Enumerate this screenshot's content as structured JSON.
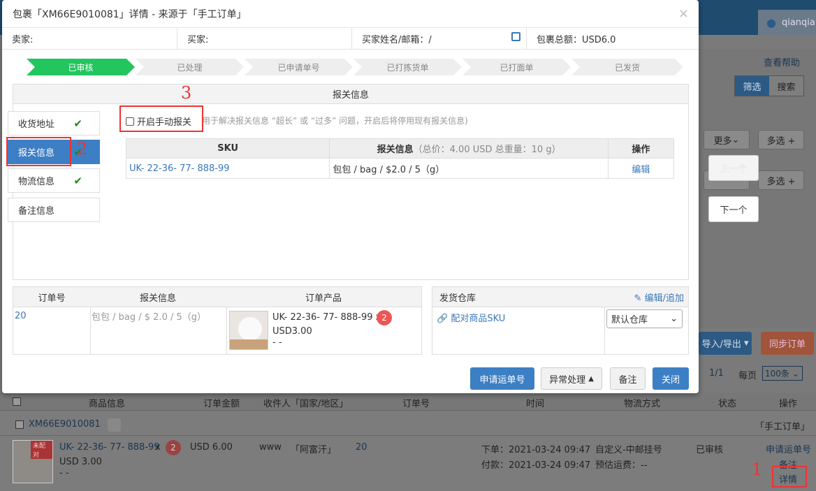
{
  "background": {
    "user_name": "qianqia",
    "help_link": "查看帮助",
    "filter_tab": "筛选",
    "search_tab": "搜索",
    "more_btn": "更多",
    "multi_btn": "多选 +",
    "import_export_btn": "导入/导出",
    "sync_btn": "同步订单",
    "pagination": "1/1",
    "per_page_label": "每页",
    "per_page_value": "100条",
    "table_headers": [
      "商品信息",
      "订单金额",
      "收件人「国家/地区」",
      "订单号",
      "时间",
      "物流方式",
      "状态",
      "操作"
    ],
    "order_id": "XM66E9010081",
    "order_source": "「手工订单」",
    "unmatched_tag": "未配对",
    "row": {
      "sku": "UK- 22-36- 77- 888-99",
      "qty_sep": "x",
      "qty": "2",
      "price": "USD 3.00",
      "dash": "- -",
      "amount": "USD 6.00",
      "recipient": "www",
      "country": "「阿富汗」",
      "order_no": "20",
      "ordered_at": "下单：2021-03-24 09:47",
      "paid_at": "付款：2021-03-24 09:47",
      "shipping": "自定义-中邮挂号",
      "est_fee": "预估运费：--",
      "status": "已审核",
      "apply_link": "申请运单号",
      "note_link": "备注",
      "detail_link": "详情"
    }
  },
  "modal": {
    "title": "包裹「XM66E9010081」详情 - 来源于「手工订单」",
    "close_glyph": "×",
    "seller_label": "卖家:",
    "buyer_label": "买家:",
    "buyer_contact_label": "买家姓名/邮箱：/",
    "package_total": "包裹总额：USD6.0",
    "steps": [
      "已审核",
      "已处理",
      "已申请单号",
      "已打拣货单",
      "已打面单",
      "已发货"
    ],
    "section_title": "报关信息",
    "nav": [
      "收货地址",
      "报关信息",
      "物流信息",
      "备注信息"
    ],
    "manual_declare_label": "开启手动报关",
    "manual_declare_hint": "用于解决报关信息 “超长” 或 “过多” 问题，开启后将停用现有报关信息)",
    "sku_table": {
      "h_sku": "SKU",
      "h_declare": "报关信息",
      "h_declare_sub": "（总价：4.00 USD 总重量：10 g）",
      "h_action": "操作",
      "sku": "UK- 22-36- 77- 888-99",
      "declare": "包包 / bag / $2.0 / 5（g）",
      "action": "编辑"
    },
    "order_table": {
      "h_order_no": "订单号",
      "h_declare": "报关信息",
      "h_product": "订单产品",
      "order_no": "20",
      "declare": "包包 / bag / $ 2.0 / 5（g）",
      "product_sku": "UK- 22-36- 77- 888-99 x",
      "product_qty": "2",
      "product_price": "USD3.00",
      "product_dash": "- -"
    },
    "warehouse": {
      "title": "发货仓库",
      "edit_link": "编辑/追加",
      "match_link": "配对商品SKU",
      "selected": "默认仓库"
    },
    "buttons": {
      "apply": "申请运单号",
      "exception": "异常处理",
      "note": "备注",
      "close": "关闭"
    }
  },
  "side_nav": {
    "prev": "上一个",
    "next": "下一个"
  },
  "annotations": [
    "1",
    "2",
    "3"
  ]
}
